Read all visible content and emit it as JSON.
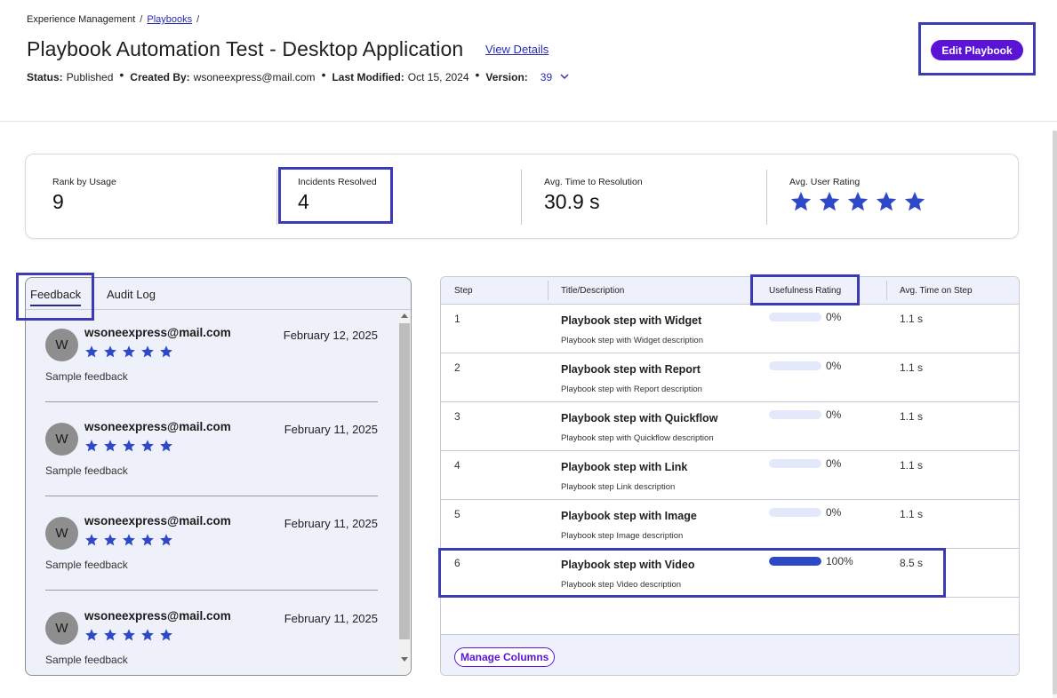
{
  "breadcrumb": {
    "root": "Experience Management",
    "link": "Playbooks",
    "sep": "/"
  },
  "page": {
    "title": "Playbook Automation Test - Desktop Application",
    "view_details": "View Details",
    "edit_button": "Edit Playbook"
  },
  "meta": {
    "status_label": "Status:",
    "status_value": "Published",
    "created_label": "Created By:",
    "created_value": "wsoneexpress@mail.com",
    "modified_label": "Last Modified:",
    "modified_value": "Oct 15, 2024",
    "version_label": "Version:",
    "version_value": "39",
    "dot": "•"
  },
  "stats": [
    {
      "label": "Rank by Usage",
      "value": "9"
    },
    {
      "label": "Incidents Resolved",
      "value": "4"
    },
    {
      "label": "Avg. Time to Resolution",
      "value": "30.9 s"
    },
    {
      "label": "Avg. User Rating",
      "value": ""
    }
  ],
  "avg_user_rating": {
    "stars": 5,
    "max": 5
  },
  "tabs": [
    "Feedback",
    "Audit Log"
  ],
  "feedback": [
    {
      "avatar": "W",
      "email": "wsoneexpress@mail.com",
      "date": "February 12, 2025",
      "stars": 5,
      "text": "Sample feedback"
    },
    {
      "avatar": "W",
      "email": "wsoneexpress@mail.com",
      "date": "February 11, 2025",
      "stars": 5,
      "text": "Sample feedback"
    },
    {
      "avatar": "W",
      "email": "wsoneexpress@mail.com",
      "date": "February 11, 2025",
      "stars": 5,
      "text": "Sample feedback"
    },
    {
      "avatar": "W",
      "email": "wsoneexpress@mail.com",
      "date": "February 11, 2025",
      "stars": 5,
      "text": "Sample feedback"
    }
  ],
  "steps_table": {
    "columns": [
      "Step",
      "Title/Description",
      "Usefulness Rating",
      "Avg. Time on Step"
    ],
    "rows": [
      {
        "step": "1",
        "title": "Playbook step with Widget",
        "desc": "Playbook step with Widget description",
        "rating": 0,
        "rating_label": "0%",
        "time": "1.1 s"
      },
      {
        "step": "2",
        "title": "Playbook step with Report",
        "desc": "Playbook step with Report description",
        "rating": 0,
        "rating_label": "0%",
        "time": "1.1 s"
      },
      {
        "step": "3",
        "title": "Playbook step with Quickflow",
        "desc": "Playbook step with Quickflow description",
        "rating": 0,
        "rating_label": "0%",
        "time": "1.1 s"
      },
      {
        "step": "4",
        "title": "Playbook step with Link",
        "desc": "Playbook step Link description",
        "rating": 0,
        "rating_label": "0%",
        "time": "1.1 s"
      },
      {
        "step": "5",
        "title": "Playbook step with Image",
        "desc": "Playbook step Image description",
        "rating": 0,
        "rating_label": "0%",
        "time": "1.1 s"
      },
      {
        "step": "6",
        "title": "Playbook step with Video",
        "desc": "Playbook step Video description",
        "rating": 100,
        "rating_label": "100%",
        "time": "8.5 s"
      }
    ],
    "manage_columns": "Manage Columns"
  },
  "colors": {
    "accent": "#5b14d6",
    "link": "#2a2ab5",
    "star": "#2e49c7",
    "highlight": "#3b3bb8"
  },
  "icons": {
    "star": "star-icon",
    "chevron": "chevron-down-icon"
  }
}
